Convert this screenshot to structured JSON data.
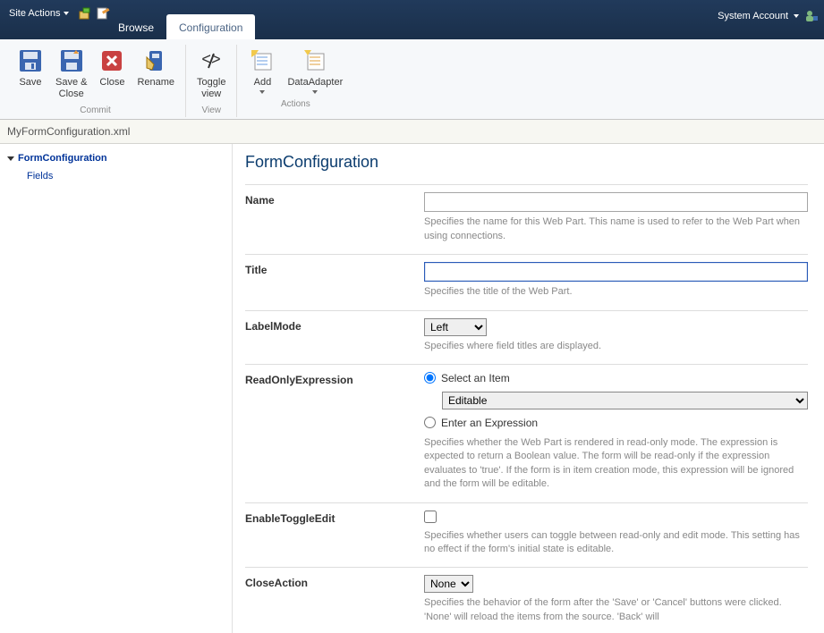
{
  "header": {
    "site_actions_label": "Site Actions",
    "account_label": "System Account",
    "tabs": {
      "browse": "Browse",
      "configuration": "Configuration"
    }
  },
  "ribbon": {
    "commit": {
      "label": "Commit",
      "save": "Save",
      "save_close": "Save &\nClose",
      "close": "Close",
      "rename": "Rename"
    },
    "view": {
      "label": "View",
      "toggle": "Toggle\nview"
    },
    "actions": {
      "label": "Actions",
      "add": "Add",
      "data_adapter": "DataAdapter"
    }
  },
  "breadcrumb": {
    "file": "MyFormConfiguration.xml"
  },
  "sidebar": {
    "root": "FormConfiguration",
    "child": "Fields"
  },
  "form": {
    "title": "FormConfiguration",
    "name": {
      "label": "Name",
      "value": "",
      "help": "Specifies the name for this Web Part. This name is used to refer to the Web Part when using connections."
    },
    "titleField": {
      "label": "Title",
      "value": "",
      "help": "Specifies the title of the Web Part."
    },
    "labelMode": {
      "label": "LabelMode",
      "value": "Left",
      "help": "Specifies where field titles are displayed."
    },
    "readOnly": {
      "label": "ReadOnlyExpression",
      "radio_item": "Select an Item",
      "select_value": "Editable",
      "radio_expr": "Enter an Expression",
      "help": "Specifies whether the Web Part is rendered in read-only mode. The expression is expected to return a Boolean value. The form will be read-only if the expression evaluates to 'true'. If the form is in item creation mode, this expression will be ignored and the form will be editable."
    },
    "enableToggle": {
      "label": "EnableToggleEdit",
      "help": "Specifies whether users can toggle between read-only and edit mode. This setting has no effect if the form's initial state is editable."
    },
    "closeAction": {
      "label": "CloseAction",
      "value": "None",
      "help": "Specifies the behavior of the form after the 'Save' or 'Cancel' buttons were clicked. 'None' will reload the items from the source. 'Back' will"
    }
  }
}
